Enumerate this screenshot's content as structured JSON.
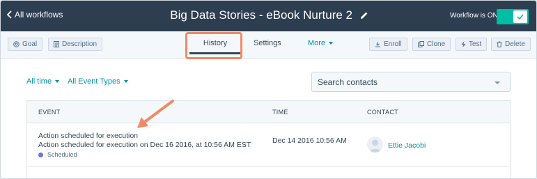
{
  "header": {
    "back_label": "All workflows",
    "title": "Big Data Stories - eBook Nurture 2",
    "workflow_status_label": "Workflow is ON"
  },
  "toolbar": {
    "goal_label": "Goal",
    "description_label": "Description",
    "tabs": [
      {
        "label": "History",
        "active": true
      },
      {
        "label": "Settings",
        "active": false
      },
      {
        "label": "More",
        "active": false
      }
    ],
    "enroll_label": "Enroll",
    "clone_label": "Clone",
    "test_label": "Test",
    "delete_label": "Delete"
  },
  "filters": {
    "time_label": "All time",
    "event_types_label": "All Event Types",
    "search_placeholder": "Search contacts"
  },
  "table": {
    "columns": [
      "EVENT",
      "TIME",
      "CONTACT"
    ],
    "rows": [
      {
        "event_title": "Action scheduled for execution",
        "event_detail": "Action scheduled for execution on Dec 16 2016, at 10:56 AM EST",
        "status": "Scheduled",
        "time": "Dec 14 2016 10:56 AM",
        "contact": "Ettie Jacobi"
      }
    ]
  },
  "colors": {
    "header_bg": "#2d3e50",
    "accent": "#0091ae",
    "toggle_on": "#00bda5",
    "highlight": "#f08a65",
    "status_dot": "#6a78d1"
  },
  "icons": [
    "chevron-left-icon",
    "pencil-icon",
    "check-icon",
    "target-icon",
    "document-icon",
    "enroll-icon",
    "clone-icon",
    "lightning-icon",
    "trash-icon"
  ]
}
